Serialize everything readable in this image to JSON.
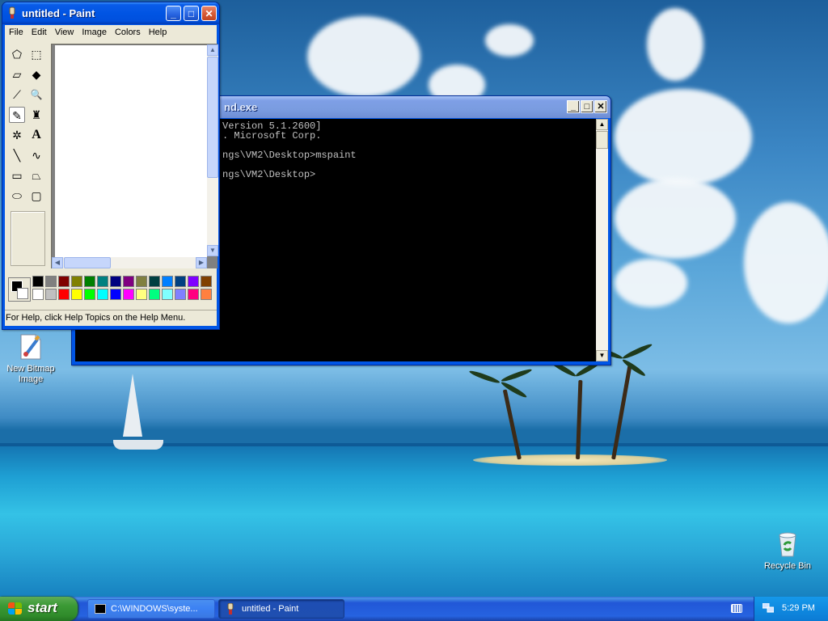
{
  "desktop": {
    "icons": [
      {
        "label_line1": "New Bitmap",
        "label_line2": "Image"
      },
      {
        "label_line1": "Recycle Bin",
        "label_line2": ""
      }
    ]
  },
  "paint": {
    "title": "untitled - Paint",
    "window_buttons": {
      "minimize": "_",
      "maximize": "□",
      "close": "✕"
    },
    "menu": [
      "File",
      "Edit",
      "View",
      "Image",
      "Colors",
      "Help"
    ],
    "tools": [
      {
        "name": "free-form-select-tool",
        "glyph": "⬠"
      },
      {
        "name": "select-tool",
        "glyph": "⬚"
      },
      {
        "name": "eraser-tool",
        "glyph": "▱"
      },
      {
        "name": "fill-tool",
        "glyph": "◆"
      },
      {
        "name": "pick-color-tool",
        "glyph": "⟋"
      },
      {
        "name": "magnifier-tool",
        "glyph": "🔍"
      },
      {
        "name": "pencil-tool",
        "glyph": "✎"
      },
      {
        "name": "brush-tool",
        "glyph": "♜"
      },
      {
        "name": "airbrush-tool",
        "glyph": "✲"
      },
      {
        "name": "text-tool",
        "glyph": "A"
      },
      {
        "name": "line-tool",
        "glyph": "╲"
      },
      {
        "name": "curve-tool",
        "glyph": "∿"
      },
      {
        "name": "rectangle-tool",
        "glyph": "▭"
      },
      {
        "name": "polygon-tool",
        "glyph": "⏢"
      },
      {
        "name": "ellipse-tool",
        "glyph": "⬭"
      },
      {
        "name": "rounded-rectangle-tool",
        "glyph": "▢"
      }
    ],
    "selected_tool": "pencil-tool",
    "palette_top": [
      "#000000",
      "#808080",
      "#800000",
      "#808000",
      "#008000",
      "#008080",
      "#000080",
      "#800080",
      "#808040",
      "#004040",
      "#0080ff",
      "#004080",
      "#8000ff",
      "#804000"
    ],
    "palette_bottom": [
      "#ffffff",
      "#c0c0c0",
      "#ff0000",
      "#ffff00",
      "#00ff00",
      "#00ffff",
      "#0000ff",
      "#ff00ff",
      "#ffff80",
      "#00ff80",
      "#80ffff",
      "#8080ff",
      "#ff0080",
      "#ff8040"
    ],
    "status": "For Help, click Help Topics on the Help Menu."
  },
  "cmd": {
    "title": "nd.exe",
    "window_buttons": {
      "minimize": "_",
      "maximize": "□",
      "close": "✕"
    },
    "lines": [
      "Version 5.1.2600]",
      ". Microsoft Corp.",
      "",
      "ngs\\VM2\\Desktop>mspaint",
      "",
      "ngs\\VM2\\Desktop>"
    ]
  },
  "taskbar": {
    "start_label": "start",
    "tasks": [
      {
        "label": "C:\\WINDOWS\\syste...",
        "active": false
      },
      {
        "label": "untitled - Paint",
        "active": true
      }
    ],
    "clock": "5:29 PM"
  }
}
